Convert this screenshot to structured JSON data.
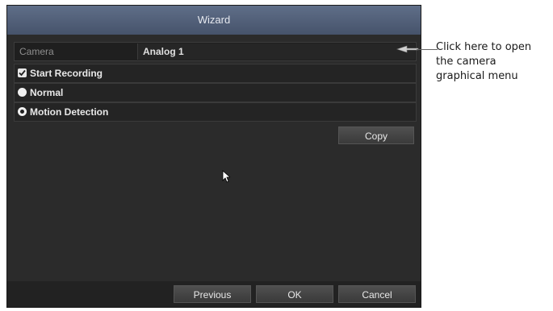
{
  "dialog": {
    "title": "Wizard",
    "camera_label": "Camera",
    "camera_value": "Analog 1",
    "options": {
      "start_recording": "Start Recording",
      "normal": "Normal",
      "motion_detection": "Motion Detection"
    },
    "copy_label": "Copy",
    "footer": {
      "previous_label": "Previous",
      "ok_label": "OK",
      "cancel_label": "Cancel"
    }
  },
  "callout": {
    "line1": "Click here to open",
    "line2": "the camera",
    "line3": "graphical menu"
  },
  "state": {
    "start_recording_checked": true,
    "selected_mode": "Motion Detection"
  },
  "colors": {
    "titlebar": "#5f6e88",
    "dialog_bg": "#2b2b2b"
  }
}
